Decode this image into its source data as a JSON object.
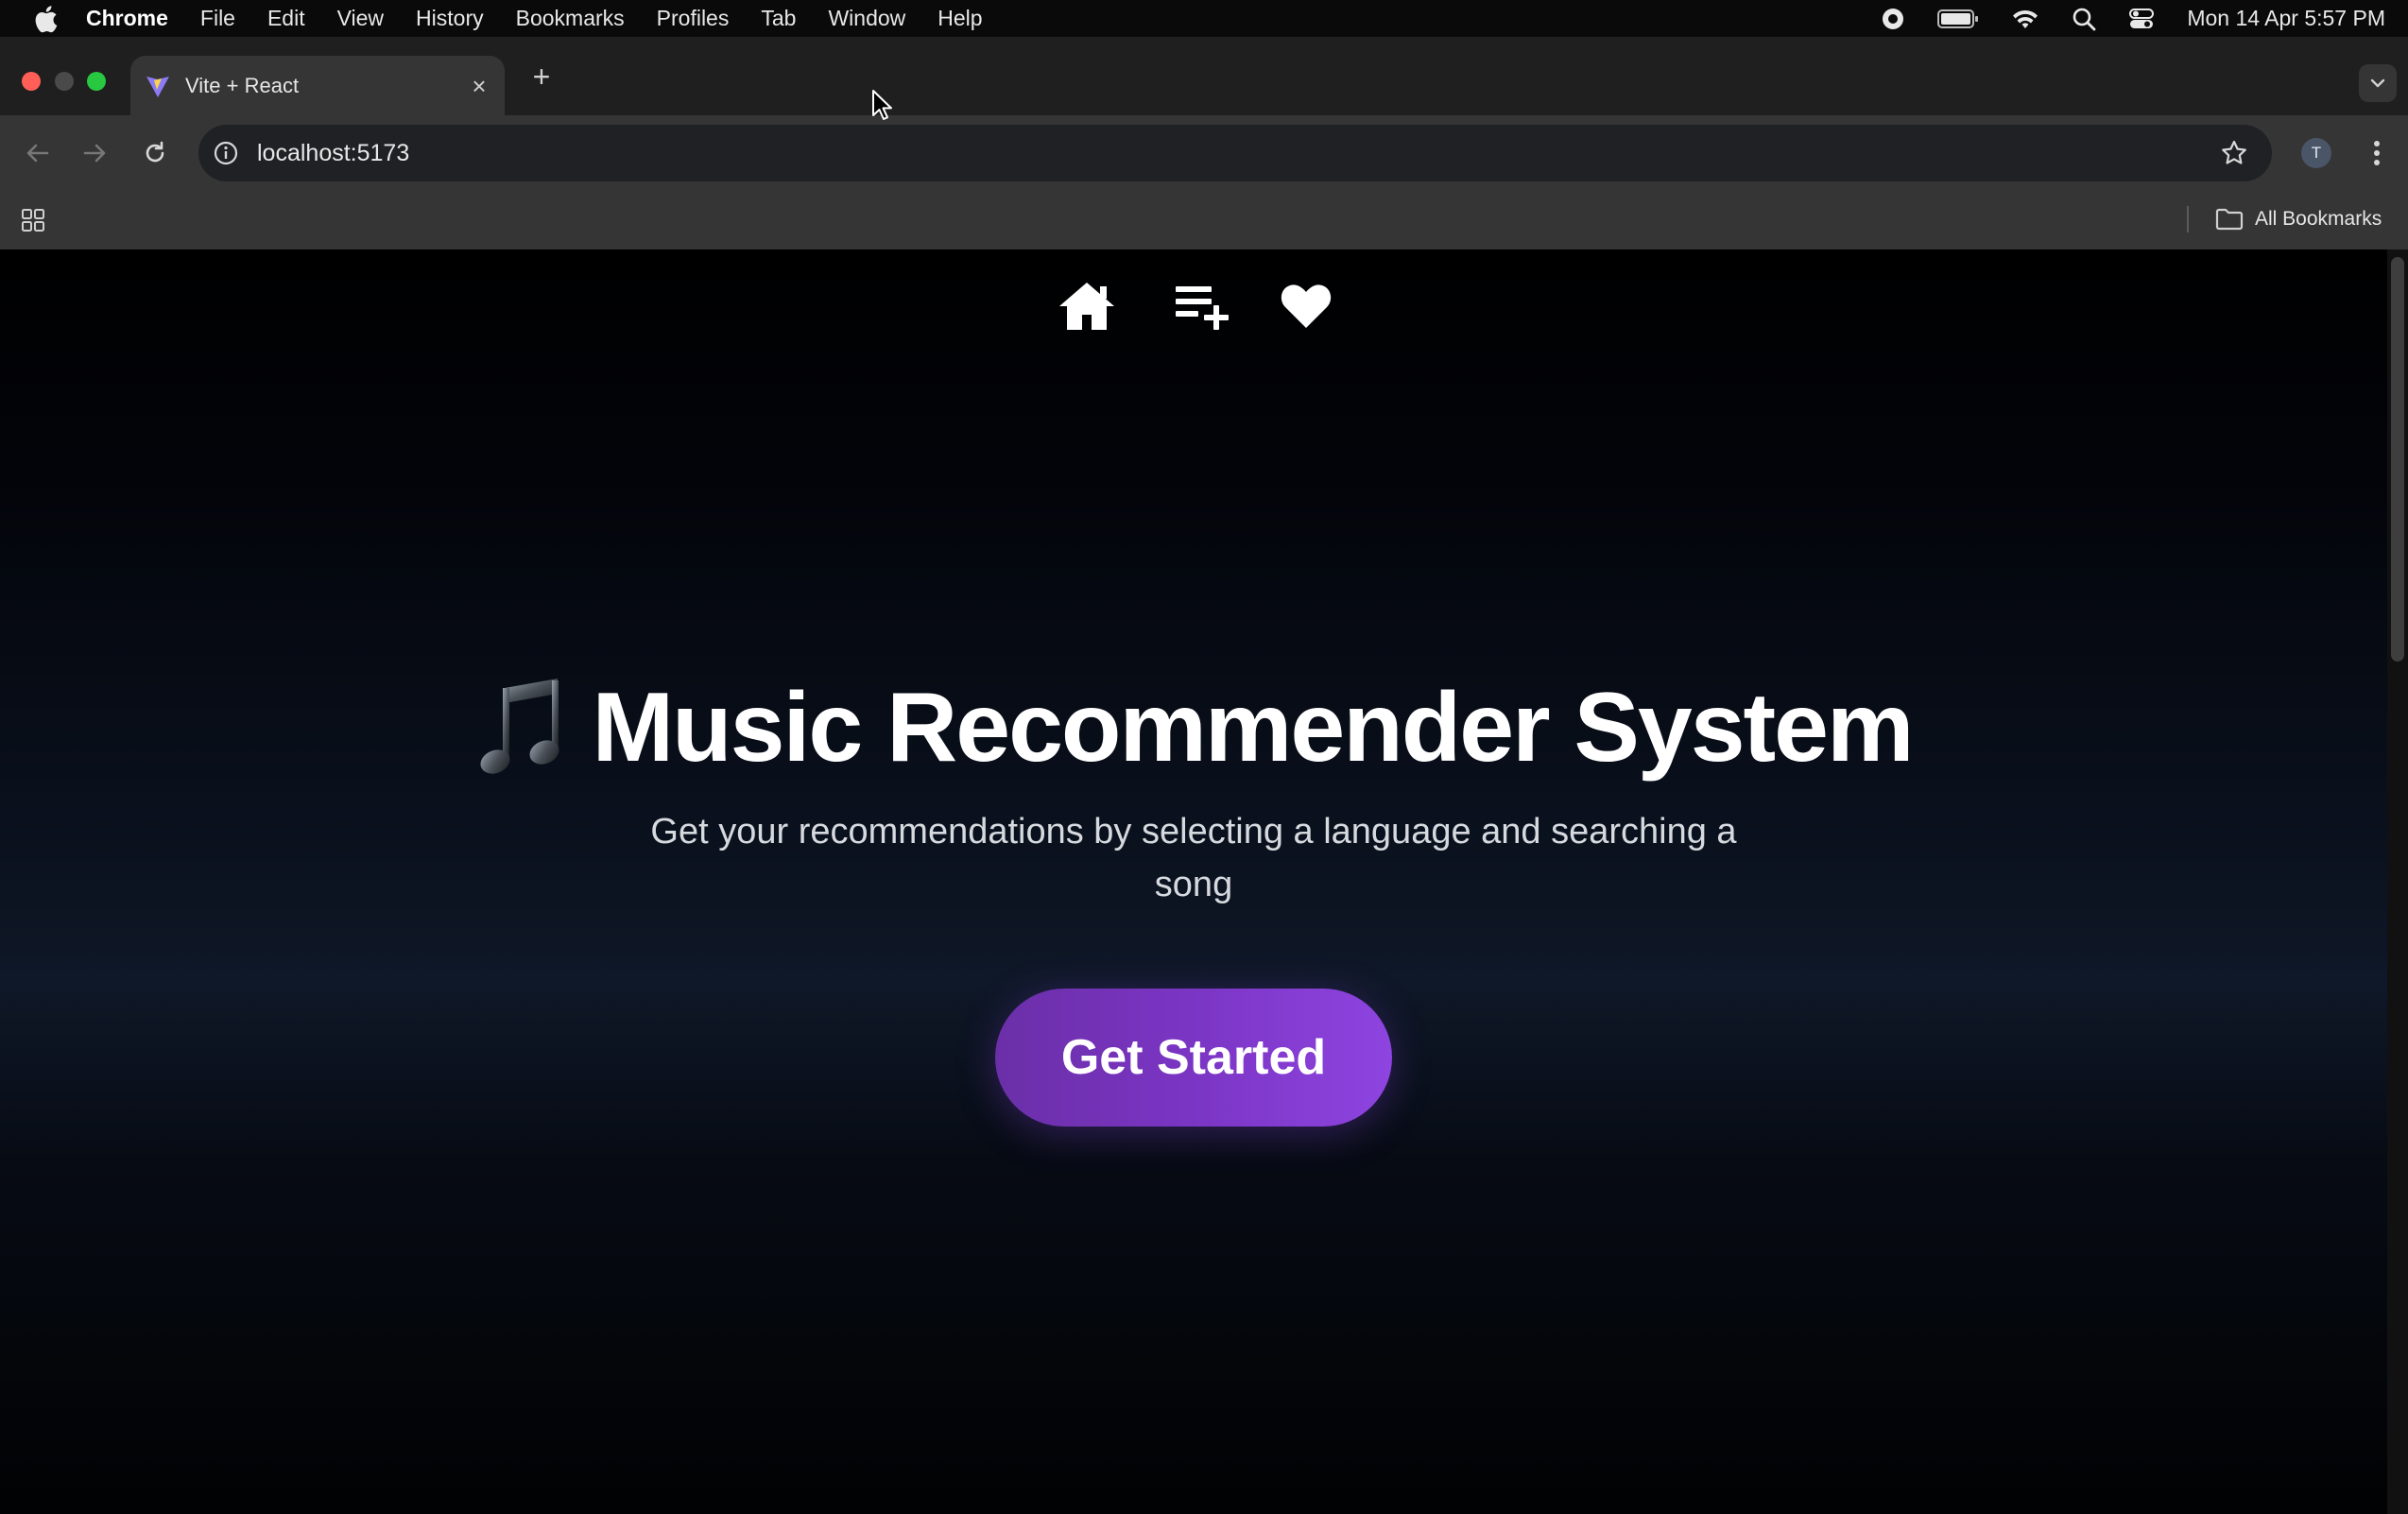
{
  "menubar": {
    "items": [
      "Chrome",
      "File",
      "Edit",
      "View",
      "History",
      "Bookmarks",
      "Profiles",
      "Tab",
      "Window",
      "Help"
    ],
    "clock": "Mon 14 Apr  5:57 PM"
  },
  "browser": {
    "tab_title": "Vite + React",
    "tab_close": "×",
    "new_tab": "+",
    "url": "localhost:5173",
    "profile_initial": "T",
    "all_bookmarks": "All Bookmarks"
  },
  "page": {
    "nav_icons": [
      "home-icon",
      "playlist-add-icon",
      "heart-icon"
    ],
    "title": "Music Recommender System",
    "subtitle": "Get your recommendations by selecting a language and searching a song",
    "cta_label": "Get Started"
  },
  "colors": {
    "cta_start": "#6b2fa8",
    "cta_end": "#8e44e0",
    "page_bg": "#000000"
  }
}
